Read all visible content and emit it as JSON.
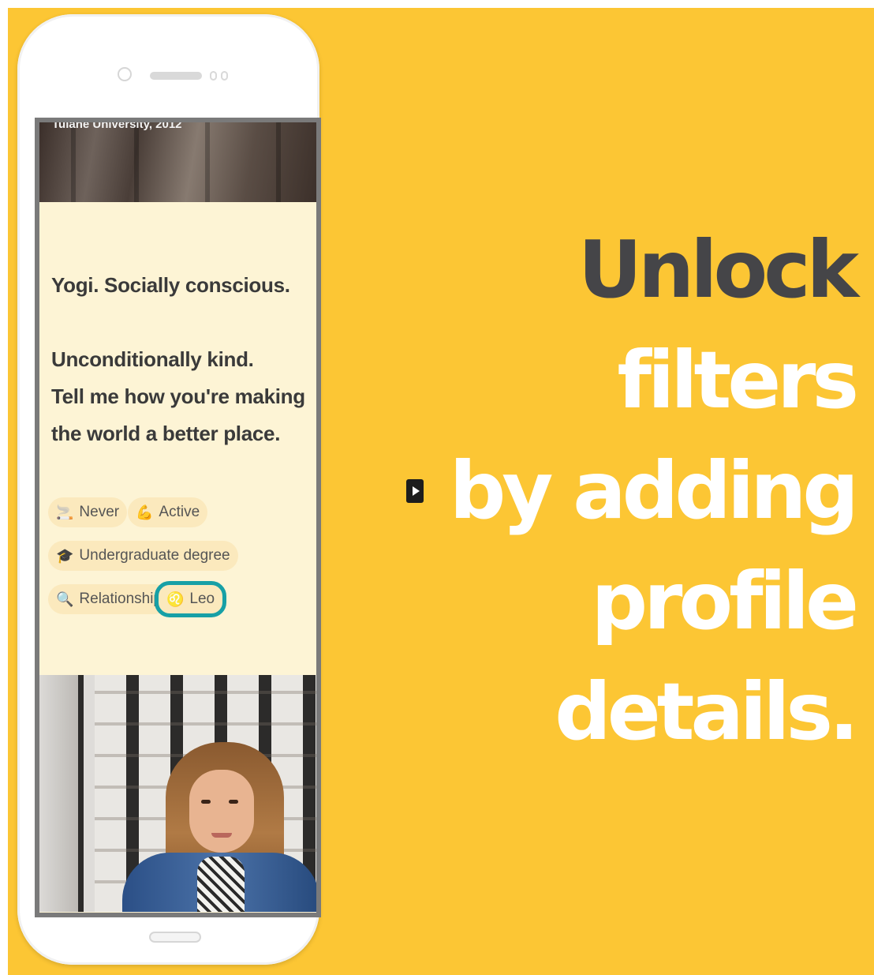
{
  "profile": {
    "education_caption": "Tulane University, 2012",
    "prompt_line1": "Yogi. Socially conscious.",
    "prompt_line2": "Unconditionally kind.",
    "prompt_line3": "Tell me how you're making",
    "prompt_line4": "the world a better place.",
    "chips": [
      {
        "icon": "smoking-icon",
        "glyph": "🚬",
        "label": "Never"
      },
      {
        "icon": "exercise-icon",
        "glyph": "💪",
        "label": "Active"
      },
      {
        "icon": "graduation-cap-icon",
        "glyph": "🎓",
        "label": "Undergraduate degree"
      },
      {
        "icon": "search-icon",
        "glyph": "🔍",
        "label": "Relationship"
      },
      {
        "icon": "zodiac-icon",
        "glyph": "♌",
        "label": "Leo"
      }
    ],
    "highlight_color": "#17a0a6"
  },
  "headline": {
    "line1": "Unlock",
    "line2": "filters",
    "line3": "by adding",
    "line4": "profile",
    "line5": "details."
  },
  "colors": {
    "background": "#fcc634",
    "headline_dark": "#454548",
    "headline_light": "#ffffff",
    "card_bg": "#fdf4d5"
  }
}
